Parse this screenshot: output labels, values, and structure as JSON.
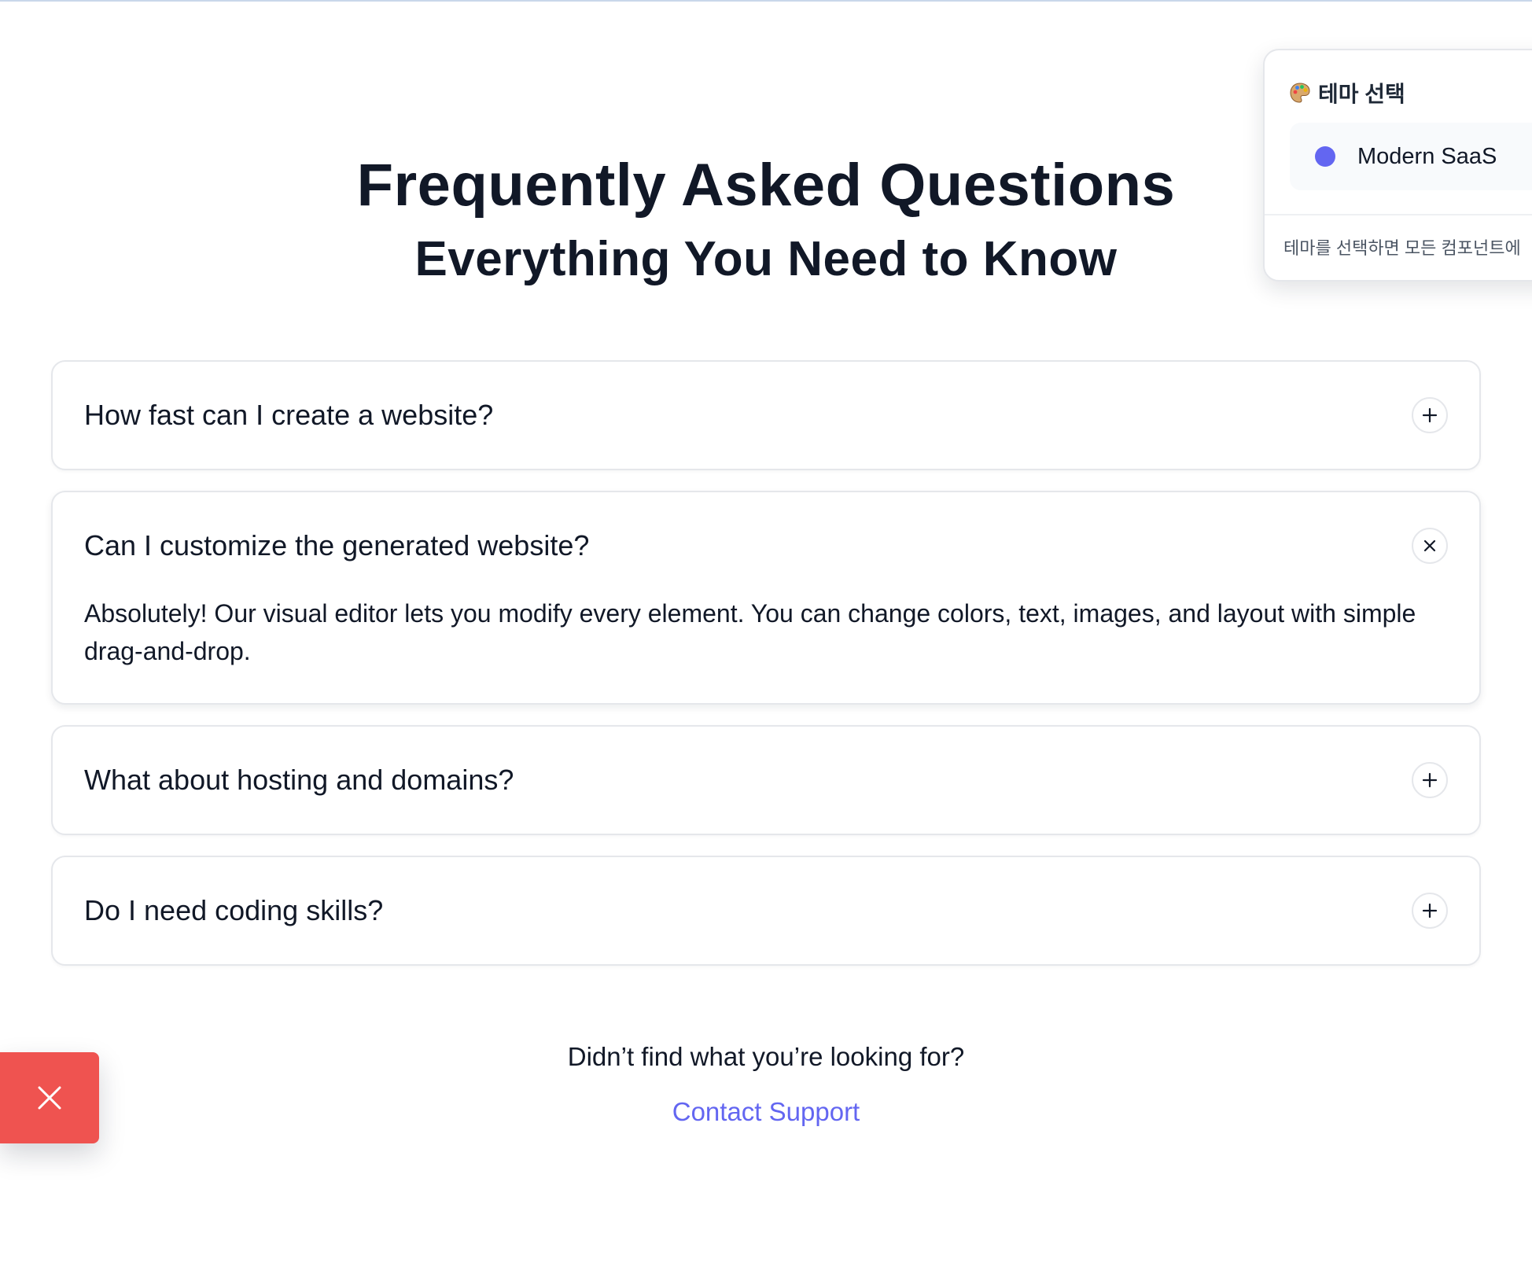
{
  "heading": {
    "title": "Frequently Asked Questions",
    "subtitle": "Everything You Need to Know"
  },
  "faq": [
    {
      "question": "How fast can I create a website?",
      "open": false,
      "toggle_icon": "plus-icon"
    },
    {
      "question": "Can I customize the generated website?",
      "open": true,
      "toggle_icon": "close-icon",
      "answer": "Absolutely! Our visual editor lets you modify every element. You can change colors, text, images, and layout with simple drag-and-drop."
    },
    {
      "question": "What about hosting and domains?",
      "open": false,
      "toggle_icon": "plus-icon"
    },
    {
      "question": "Do I need coding skills?",
      "open": false,
      "toggle_icon": "plus-icon"
    }
  ],
  "help": {
    "text": "Didn’t find what you’re looking for?",
    "link": "Contact Support"
  },
  "theme_panel": {
    "title": "테마 선택",
    "icon": "palette-icon",
    "selected_theme": "Modern SaaS",
    "selected_color": "#6366f1",
    "footer": "테마를 선택하면 모든 컴포넌트에"
  },
  "floating_button": {
    "icon": "close-icon",
    "color": "#ef5350"
  },
  "colors": {
    "accent": "#6366f1",
    "text": "#111827",
    "border": "#e5e7eb"
  }
}
